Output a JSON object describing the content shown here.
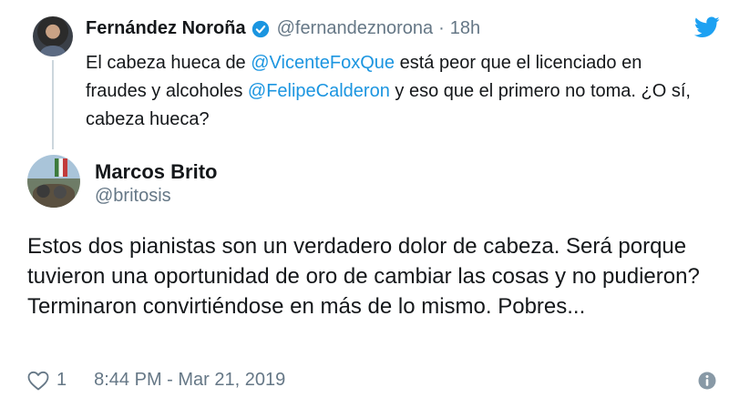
{
  "parent_tweet": {
    "name": "Fernández Noroña",
    "handle": "@fernandeznorona",
    "separator": "·",
    "time": "18h",
    "text": {
      "t1": "El cabeza hueca de ",
      "m1": "@VicenteFoxQue",
      "t2": " está peor que el licenciado en fraudes y alcoholes ",
      "m2": "@FelipeCalderon",
      "t3": " y eso que el primero no toma. ¿O sí, cabeza hueca?"
    }
  },
  "reply": {
    "name": "Marcos Brito",
    "handle": "@britosis",
    "text": "Estos dos pianistas son un verdadero dolor de cabeza. Será porque tuvieron una oportunidad de oro de cambiar las cosas y no pudieron? Terminaron convirtiéndose en más de lo mismo. Pobres...",
    "likes": "1",
    "timestamp": "8:44 PM - Mar 21, 2019"
  },
  "icons": {
    "verified": "verified-badge-icon",
    "brand": "twitter-bird-icon",
    "like": "heart-icon",
    "info": "info-icon"
  },
  "colors": {
    "accent": "#1b95e0",
    "muted": "#657786",
    "text": "#14171a",
    "thread_line": "#ccd6dd"
  }
}
